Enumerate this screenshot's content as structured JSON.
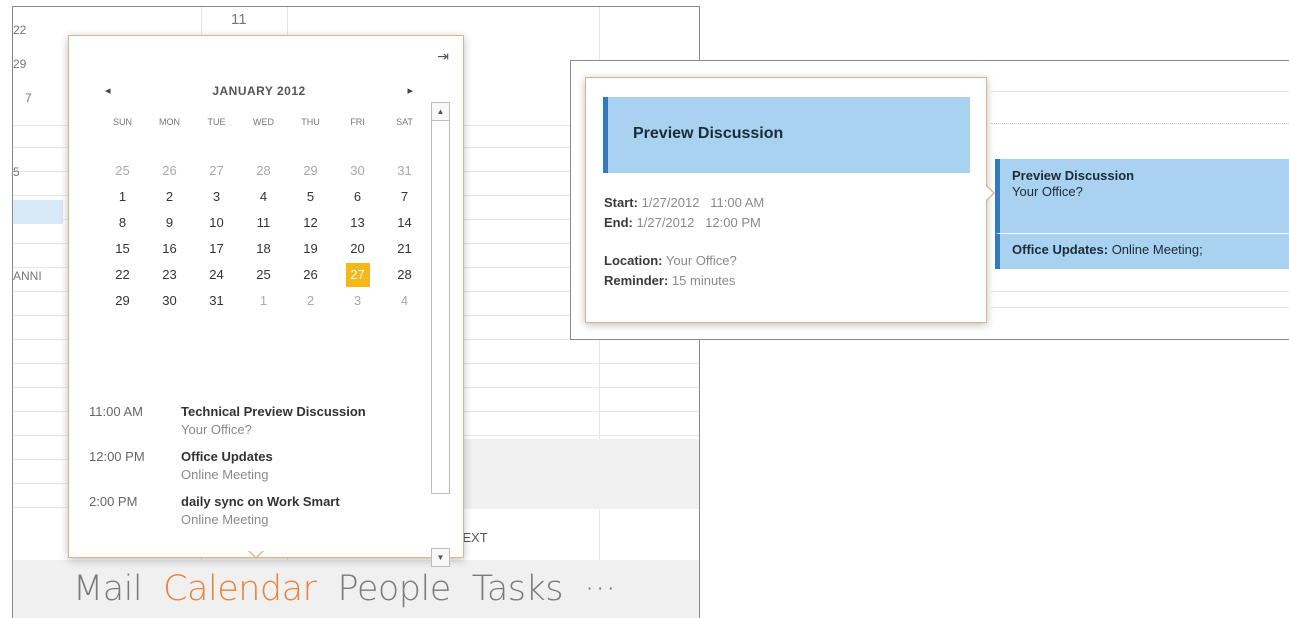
{
  "left_window": {
    "background_fragments": {
      "week_numbers": [
        "22",
        "29",
        "7",
        "5"
      ],
      "col_label": "11",
      "plan_label": "ANNI",
      "next_label": "NEXT"
    },
    "calendar_flyout": {
      "month_title": "JANUARY 2012",
      "prev_icon": "◂",
      "next_icon": "▸",
      "pin_icon": "⇥",
      "day_headers": [
        "SUN",
        "MON",
        "TUE",
        "WED",
        "THU",
        "FRI",
        "SAT"
      ],
      "days": [
        {
          "d": "25",
          "other": true
        },
        {
          "d": "26",
          "other": true
        },
        {
          "d": "27",
          "other": true
        },
        {
          "d": "28",
          "other": true
        },
        {
          "d": "29",
          "other": true
        },
        {
          "d": "30",
          "other": true
        },
        {
          "d": "31",
          "other": true
        },
        {
          "d": "1"
        },
        {
          "d": "2"
        },
        {
          "d": "3"
        },
        {
          "d": "4"
        },
        {
          "d": "5"
        },
        {
          "d": "6"
        },
        {
          "d": "7"
        },
        {
          "d": "8"
        },
        {
          "d": "9"
        },
        {
          "d": "10"
        },
        {
          "d": "11"
        },
        {
          "d": "12"
        },
        {
          "d": "13"
        },
        {
          "d": "14"
        },
        {
          "d": "15"
        },
        {
          "d": "16"
        },
        {
          "d": "17"
        },
        {
          "d": "18"
        },
        {
          "d": "19"
        },
        {
          "d": "20"
        },
        {
          "d": "21"
        },
        {
          "d": "22"
        },
        {
          "d": "23"
        },
        {
          "d": "24"
        },
        {
          "d": "25"
        },
        {
          "d": "26"
        },
        {
          "d": "27",
          "today": true
        },
        {
          "d": "28"
        },
        {
          "d": "29"
        },
        {
          "d": "30"
        },
        {
          "d": "31"
        },
        {
          "d": "1",
          "other": true
        },
        {
          "d": "2",
          "other": true
        },
        {
          "d": "3",
          "other": true
        },
        {
          "d": "4",
          "other": true
        }
      ],
      "agenda": [
        {
          "time": "11:00 AM",
          "title": "Technical Preview Discussion",
          "location": "Your Office?"
        },
        {
          "time": "12:00 PM",
          "title": "Office Updates",
          "location": "Online Meeting"
        },
        {
          "time": "2:00 PM",
          "title": "daily sync on Work Smart",
          "location": "Online Meeting"
        }
      ],
      "accent_today": "#f5b818"
    },
    "bottom_nav": {
      "items": [
        {
          "label": "Mail",
          "active": false
        },
        {
          "label": "Calendar",
          "active": true
        },
        {
          "label": "People",
          "active": false
        },
        {
          "label": "Tasks",
          "active": false
        },
        {
          "label": "···",
          "active": false
        }
      ],
      "active_color": "#e8833a"
    }
  },
  "right_window": {
    "peek": {
      "title": "Preview Discussion",
      "start_label": "Start:",
      "start_value": "1/27/2012   11:00 AM",
      "end_label": "End:",
      "end_value": "1/27/2012   12:00 PM",
      "location_label": "Location:",
      "location_value": "Your Office?",
      "reminder_label": "Reminder:",
      "reminder_value": "15 minutes"
    },
    "event1": {
      "title": "Preview Discussion",
      "location": "Your Office?"
    },
    "event2": {
      "title": "Office Updates:",
      "detail": " Online Meeting;"
    },
    "event_color": "#a9d1f0",
    "event_border": "#3478c0"
  }
}
